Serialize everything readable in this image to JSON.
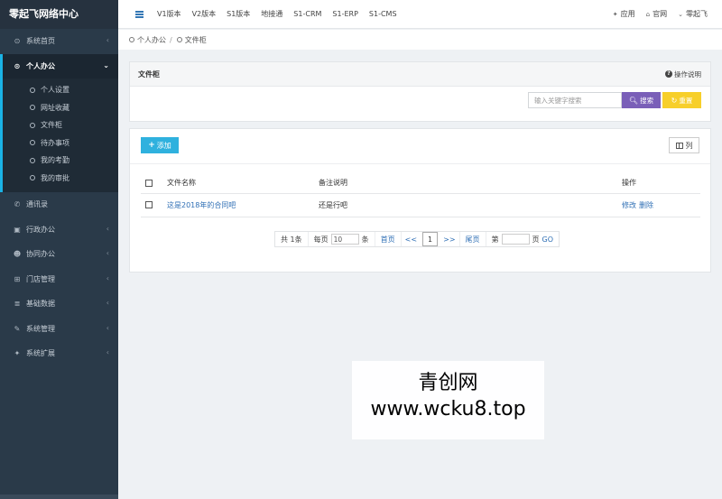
{
  "brand": "零起飞网络中心",
  "sidebar": {
    "items": [
      {
        "label": "系统首页",
        "icon": "dashboard-icon"
      },
      {
        "label": "个人办公",
        "icon": "target-icon"
      },
      {
        "label": "通讯录",
        "icon": "phone-icon"
      },
      {
        "label": "行政办公",
        "icon": "briefcase-icon"
      },
      {
        "label": "协同办公",
        "icon": "users-icon"
      },
      {
        "label": "门店管理",
        "icon": "sitemap-icon"
      },
      {
        "label": "基础数据",
        "icon": "database-icon"
      },
      {
        "label": "系统管理",
        "icon": "wrench-icon"
      },
      {
        "label": "系统扩展",
        "icon": "rocket-icon"
      }
    ],
    "subitems": [
      "个人设置",
      "网址收藏",
      "文件柜",
      "待办事项",
      "我的考勤",
      "我的审批"
    ]
  },
  "topbar": {
    "links": [
      "V1版本",
      "V2版本",
      "S1版本",
      "地接通",
      "S1-CRM",
      "S1-ERP",
      "S1-CMS"
    ],
    "right": [
      {
        "label": "应用",
        "icon": "rocket-icon"
      },
      {
        "label": "官网",
        "icon": "home-icon"
      },
      {
        "label": "零起飞",
        "icon": "chevron-down-icon"
      }
    ]
  },
  "breadcrumb": [
    "个人办公",
    "文件柜"
  ],
  "panel": {
    "title": "文件柜",
    "help": "操作说明",
    "search_placeholder": "输入关键字搜索",
    "search_label": "搜索",
    "reset_label": "重置"
  },
  "toolbar": {
    "add_label": "添加",
    "columns_label": "列"
  },
  "table": {
    "headers": [
      "文件名称",
      "备注说明",
      "操作"
    ],
    "rows": [
      {
        "name": "这是2018年的合同吧",
        "note": "还是行吧",
        "edit": "修改",
        "delete": "删除"
      }
    ]
  },
  "pager": {
    "total": "共 1条",
    "per_page_label": "每页",
    "per_page_value": "10",
    "per_page_unit": "条",
    "first": "首页",
    "prev": "<<",
    "current": "1",
    "next": ">>",
    "last": "尾页",
    "jump_label": "第",
    "page_unit": "页",
    "go": "GO"
  },
  "watermark": {
    "line1": "青创网",
    "line2": "www.wcku8.top"
  },
  "colors": {
    "sidebar_bg": "#2a3a49",
    "accent": "#1ab3e6",
    "search_btn": "#7a5fb8",
    "reset_btn": "#f7cf2a",
    "add_btn": "#2fb1de",
    "link": "#2f6fb5"
  }
}
